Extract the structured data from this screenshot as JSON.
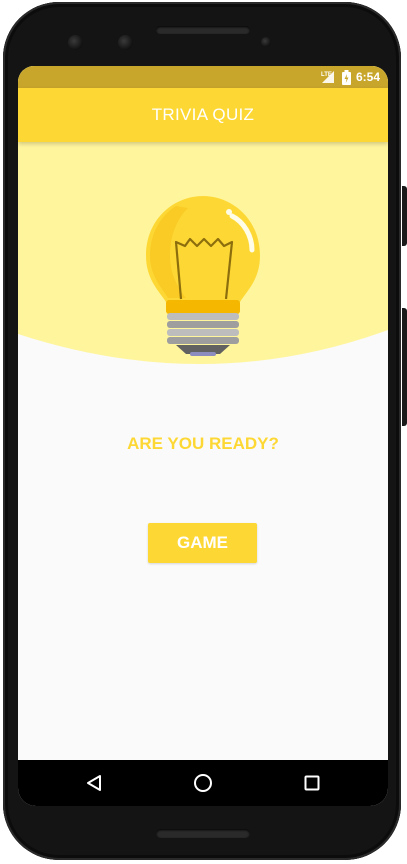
{
  "status_bar": {
    "network": "LTE",
    "time": "6:54",
    "icons": [
      "lte-signal-icon",
      "battery-charging-icon"
    ]
  },
  "app_bar": {
    "title": "TRIVIA QUIZ"
  },
  "hero": {
    "icon": "lightbulb-icon"
  },
  "main": {
    "prompt": "ARE YOU READY?",
    "game_button_label": "GAME"
  },
  "nav_bar": {
    "items": [
      "back-icon",
      "home-icon",
      "recents-icon"
    ]
  },
  "colors": {
    "accent": "#fdd835",
    "status_bar": "#c8a62c",
    "hero_background": "#fff59d",
    "screen_background": "#fafafa"
  }
}
